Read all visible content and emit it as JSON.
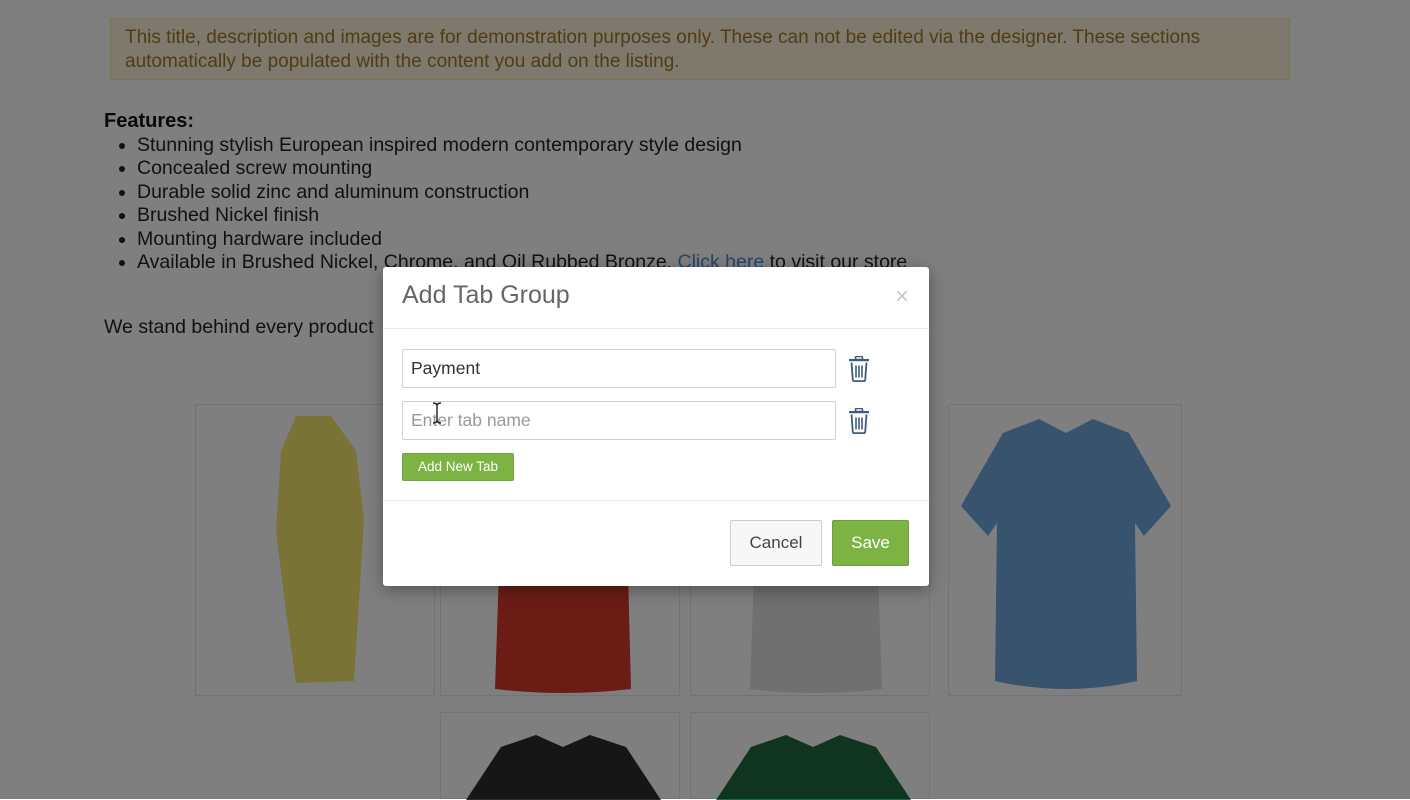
{
  "listing": {
    "demo_notice": "This title, description and images are for demonstration purposes only. These can not be edited via the designer. These sections automatically be populated with the content you add on the listing.",
    "features_heading": "Features:",
    "features": [
      "Stunning stylish European inspired modern contemporary style design",
      "Concealed screw mounting",
      "Durable solid zinc and aluminum construction",
      "Brushed Nickel finish",
      "Mounting hardware included"
    ],
    "availability_text": "Available in Brushed Nickel, Chrome, and Oil Rubbed Bronze.",
    "store_link_label": "Click here",
    "store_link_suffix": "to visit our store",
    "guarantee_text": "We stand behind every product"
  },
  "gallery": {
    "shirt_colors": [
      "#f2e86a",
      "#d63b2a",
      "#e0e0e0",
      "#6ea6dc",
      "#2d2d2d",
      "#1f6b43"
    ],
    "icon": "polo-shirt-icon"
  },
  "modal": {
    "title": "Add Tab Group",
    "close_label": "×",
    "tabs": [
      {
        "value": "Payment",
        "placeholder": "Enter tab name"
      },
      {
        "value": "",
        "placeholder": "Enter tab name"
      }
    ],
    "add_tab_label": "Add New Tab",
    "cancel_label": "Cancel",
    "save_label": "Save"
  },
  "colors": {
    "accent_green": "#7cb342",
    "overlay": "rgba(0,0,0,0.5)",
    "trash_icon": "#3d5a80",
    "notice_bg": "#fdf3d9"
  }
}
